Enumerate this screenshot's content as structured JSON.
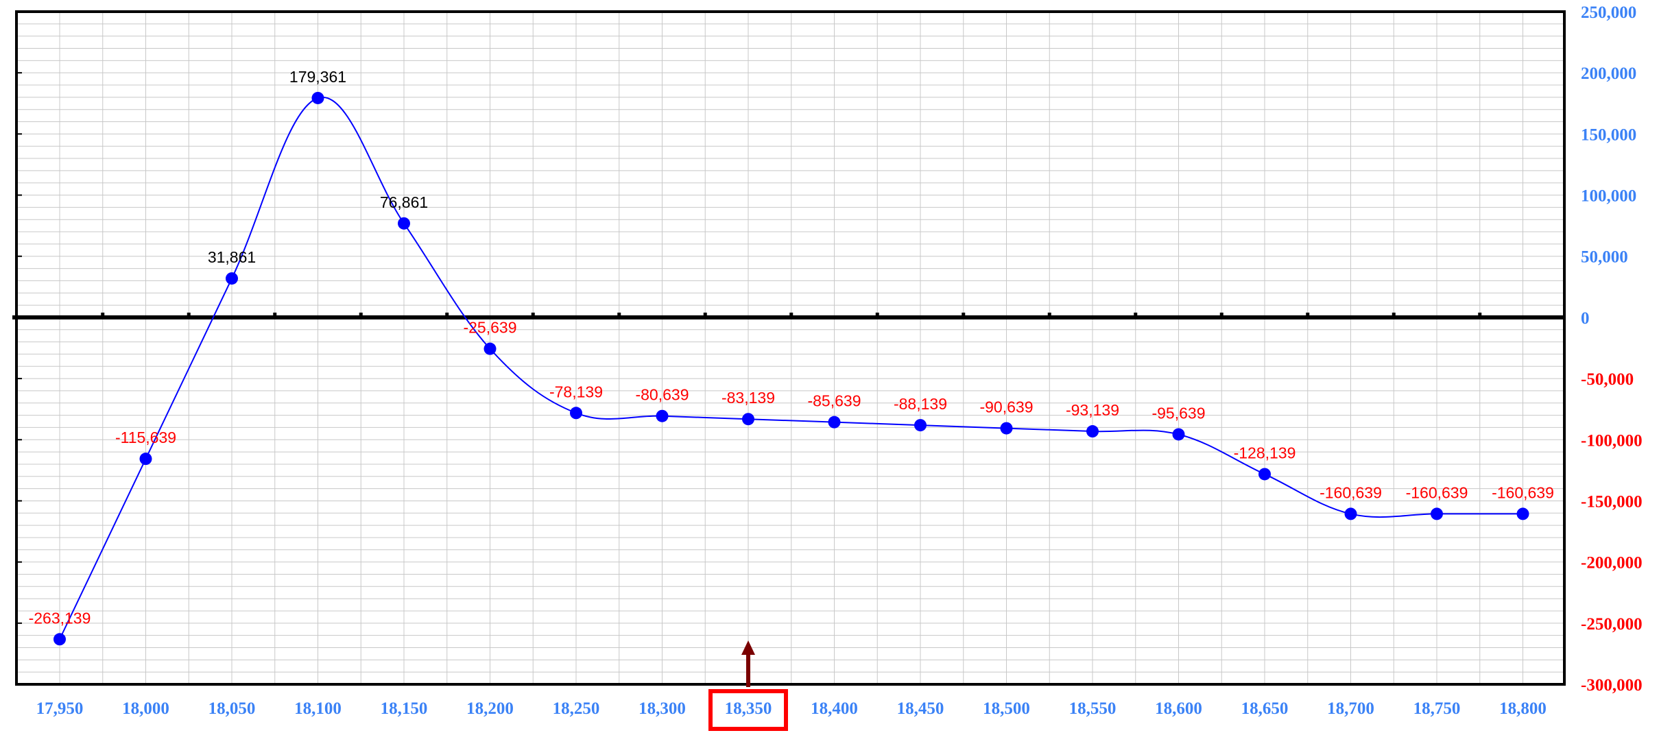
{
  "colors": {
    "line": "#0000ff",
    "marker": "#0000ff",
    "positive_label": "#000000",
    "negative_label": "#ff0000",
    "x_tick": "#3b82f6",
    "y_tick_positive": "#3b82f6",
    "y_tick_negative": "#ff0000",
    "highlight_box": "#ff0000",
    "arrow": "#7a0000",
    "grid": "#c8c8c8",
    "frame": "#000000"
  },
  "chart_data": {
    "type": "line",
    "title": "",
    "xlabel": "",
    "ylabel": "",
    "smooth": true,
    "grid": true,
    "y_axis_side": "right",
    "x": [
      17950,
      18000,
      18050,
      18100,
      18150,
      18200,
      18250,
      18300,
      18350,
      18400,
      18450,
      18500,
      18550,
      18600,
      18650,
      18700,
      18750,
      18800
    ],
    "x_tick_labels": [
      "17,950",
      "18,000",
      "18,050",
      "18,100",
      "18,150",
      "18,200",
      "18,250",
      "18,300",
      "18,350",
      "18,400",
      "18,450",
      "18,500",
      "18,550",
      "18,600",
      "18,650",
      "18,700",
      "18,750",
      "18,800"
    ],
    "series": [
      {
        "values": [
          -263139,
          -115639,
          31861,
          179361,
          76861,
          -25639,
          -78139,
          -80639,
          -83139,
          -85639,
          -88139,
          -90639,
          -93139,
          -95639,
          -128139,
          -160639,
          -160639,
          -160639
        ],
        "labels": [
          "-263,139",
          "-115,639",
          "31,861",
          "179,361",
          "76,861",
          "-25,639",
          "-78,139",
          "-80,639",
          "-83,139",
          "-85,639",
          "-88,139",
          "-90,639",
          "-93,139",
          "-95,639",
          "-128,139",
          "-160,639",
          "-160,639",
          "-160,639"
        ]
      }
    ],
    "ylim": [
      -300000,
      250000
    ],
    "y_ticks": [
      250000,
      200000,
      150000,
      100000,
      50000,
      0,
      -50000,
      -100000,
      -150000,
      -200000,
      -250000,
      -300000
    ],
    "y_tick_labels": [
      "250,000",
      "200,000",
      "150,000",
      "100,000",
      "50,000",
      "0",
      "-50,000",
      "-100,000",
      "-150,000",
      "-200,000",
      "-250,000",
      "-300,000"
    ],
    "left_inner_ticks": [
      200000,
      150000,
      100000,
      50000,
      -50000,
      -100000,
      -150000,
      -200000,
      -250000
    ],
    "highlight": {
      "x": 18350,
      "label": "18,350",
      "arrow": true
    }
  }
}
